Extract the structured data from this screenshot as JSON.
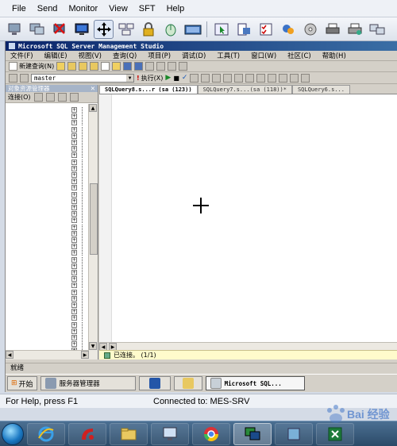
{
  "viewer_menu": [
    "File",
    "Send",
    "Monitor",
    "View",
    "SFT",
    "Help"
  ],
  "viewer_toolbar_icons": [
    "computer-icon",
    "connect-icon",
    "disconnect-icon",
    "screen-icon",
    "move-icon",
    "ctrl-alt-del-icon",
    "lock-icon",
    "mouse-icon",
    "keyboard-icon",
    "cursor-icon",
    "snapshot-icon",
    "checklist-icon",
    "puzzle-icon",
    "cd-icon",
    "printer-icon",
    "printer2-icon",
    "screens-icon"
  ],
  "ssms": {
    "title": "Microsoft SQL Server Management Studio",
    "menu": [
      "文件(F)",
      "编辑(E)",
      "视图(V)",
      "查询(Q)",
      "项目(P)",
      "调试(D)",
      "工具(T)",
      "窗口(W)",
      "社区(C)",
      "帮助(H)"
    ],
    "new_query_label": "新建查询(N)",
    "database": "master",
    "execute_label": "执行(X)",
    "object_explorer": {
      "title": "对象资源管理器",
      "connect_label": "连接(O)"
    },
    "tabs": [
      "SQLQuery8.s...r (sa (123))",
      "SQLQuery7.s...(sa (118))*",
      "SQLQuery6.s..."
    ],
    "status_message": "已连接。 (1/1)",
    "status_bar": "就绪",
    "remote_taskbar": {
      "start_label": "开始",
      "server_manager_label": "服务器管理器",
      "active_window_label": "Microsoft SQL..."
    }
  },
  "viewer_status": {
    "help_text": "For Help, press F1",
    "connection_text": "Connected to: MES-SRV"
  },
  "taskbar": {
    "items": [
      "ie-icon",
      "app-red-icon",
      "folder-icon",
      "monitor-icon",
      "chrome-icon",
      "remote-viewer-icon",
      "app-blank-icon",
      "excel-icon"
    ],
    "active_index": 5
  },
  "watermark": "Bai 经验"
}
